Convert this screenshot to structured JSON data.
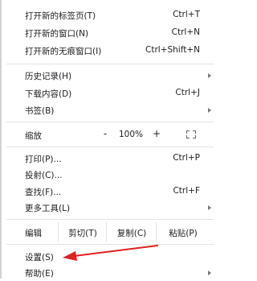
{
  "menu": {
    "new_tab": {
      "label": "打开新的标签页(T)",
      "shortcut": "Ctrl+T"
    },
    "new_window": {
      "label": "打开新的窗口(N)",
      "shortcut": "Ctrl+N"
    },
    "new_incognito": {
      "label": "打开新的无痕窗口(I)",
      "shortcut": "Ctrl+Shift+N"
    },
    "history": {
      "label": "历史记录(H)"
    },
    "downloads": {
      "label": "下载内容(D)",
      "shortcut": "Ctrl+J"
    },
    "bookmarks": {
      "label": "书签(B)"
    },
    "zoom": {
      "label": "缩放",
      "minus": "-",
      "value": "100%",
      "plus": "+"
    },
    "print": {
      "label": "打印(P)...",
      "shortcut": "Ctrl+P"
    },
    "cast": {
      "label": "投射(C)..."
    },
    "find": {
      "label": "查找(F)...",
      "shortcut": "Ctrl+F"
    },
    "more_tools": {
      "label": "更多工具(L)"
    },
    "edit": {
      "label": "编辑",
      "cut": "剪切(T)",
      "copy": "复制(C)",
      "paste": "粘贴(P)"
    },
    "settings": {
      "label": "设置(S)"
    },
    "help": {
      "label": "帮助(E)"
    }
  },
  "colors": {
    "annotation_arrow": "#e02020"
  },
  "icons": {
    "submenu": "chevron-right-icon",
    "fullscreen": "fullscreen-icon"
  }
}
